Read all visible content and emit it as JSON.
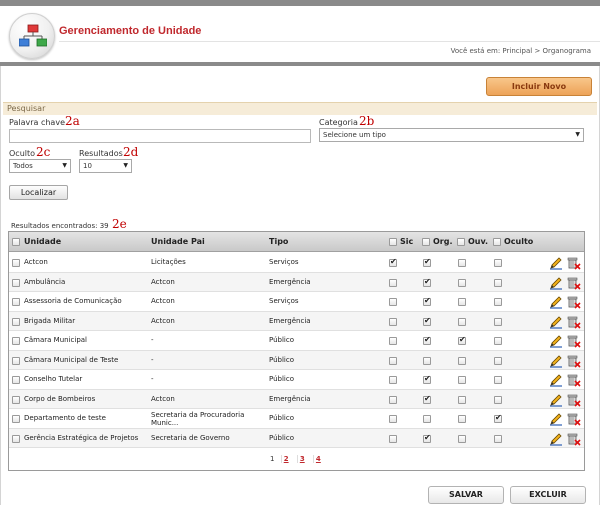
{
  "header": {
    "title": "Gerenciamento de Unidade",
    "breadcrumb": "Você está em: Principal > Organograma",
    "logo_icon": "org-chart-icon"
  },
  "actions": {
    "new_label": "Incluir Novo",
    "save_label": "SALVAR",
    "delete_label": "EXCLUIR"
  },
  "search": {
    "section_title": "Pesquisar",
    "keyword_label": "Palavra chave",
    "keyword_value": "",
    "category_label": "Categoria",
    "category_value": "Selecione um tipo",
    "hidden_label": "Oculto",
    "hidden_value": "Todos",
    "results_label": "Resultados",
    "results_value": "10",
    "find_label": "Localizar"
  },
  "annotations": {
    "a": "2a",
    "b": "2b",
    "c": "2c",
    "d": "2d",
    "e": "2e"
  },
  "results_text": "Resultados encontrados: 39",
  "table": {
    "headers": {
      "unidade": "Unidade",
      "pai": "Unidade Pai",
      "tipo": "Tipo",
      "sic": "Sic",
      "org": "Org.",
      "ouv": "Ouv.",
      "oculto": "Oculto"
    },
    "rows": [
      {
        "unidade": "Actcon",
        "pai": "Licitações",
        "tipo": "Serviços",
        "sic": true,
        "org": true,
        "ouv": false,
        "oculto": false
      },
      {
        "unidade": "Ambulância",
        "pai": "Actcon",
        "tipo": "Emergência",
        "sic": false,
        "org": true,
        "ouv": false,
        "oculto": false
      },
      {
        "unidade": "Assessoria de Comunicação",
        "pai": "Actcon",
        "tipo": "Serviços",
        "sic": false,
        "org": true,
        "ouv": false,
        "oculto": false
      },
      {
        "unidade": "Brigada Militar",
        "pai": "Actcon",
        "tipo": "Emergência",
        "sic": false,
        "org": true,
        "ouv": false,
        "oculto": false
      },
      {
        "unidade": "Câmara Municipal",
        "pai": "-",
        "tipo": "Público",
        "sic": false,
        "org": true,
        "ouv": true,
        "oculto": false
      },
      {
        "unidade": "Câmara Municipal de Teste",
        "pai": "-",
        "tipo": "Público",
        "sic": false,
        "org": false,
        "ouv": false,
        "oculto": false
      },
      {
        "unidade": "Conselho Tutelar",
        "pai": "-",
        "tipo": "Público",
        "sic": false,
        "org": true,
        "ouv": false,
        "oculto": false
      },
      {
        "unidade": "Corpo de Bombeiros",
        "pai": "Actcon",
        "tipo": "Emergência",
        "sic": false,
        "org": true,
        "ouv": false,
        "oculto": false
      },
      {
        "unidade": "Departamento de teste",
        "pai": "Secretaria da Procuradoria Munic...",
        "tipo": "Público",
        "sic": false,
        "org": false,
        "ouv": false,
        "oculto": true
      },
      {
        "unidade": "Gerência Estratégica de Projetos",
        "pai": "Secretaria de Governo",
        "tipo": "Público",
        "sic": false,
        "org": true,
        "ouv": false,
        "oculto": false
      }
    ]
  },
  "pagination": {
    "current": "1",
    "pages": [
      "2",
      "3",
      "4"
    ]
  }
}
